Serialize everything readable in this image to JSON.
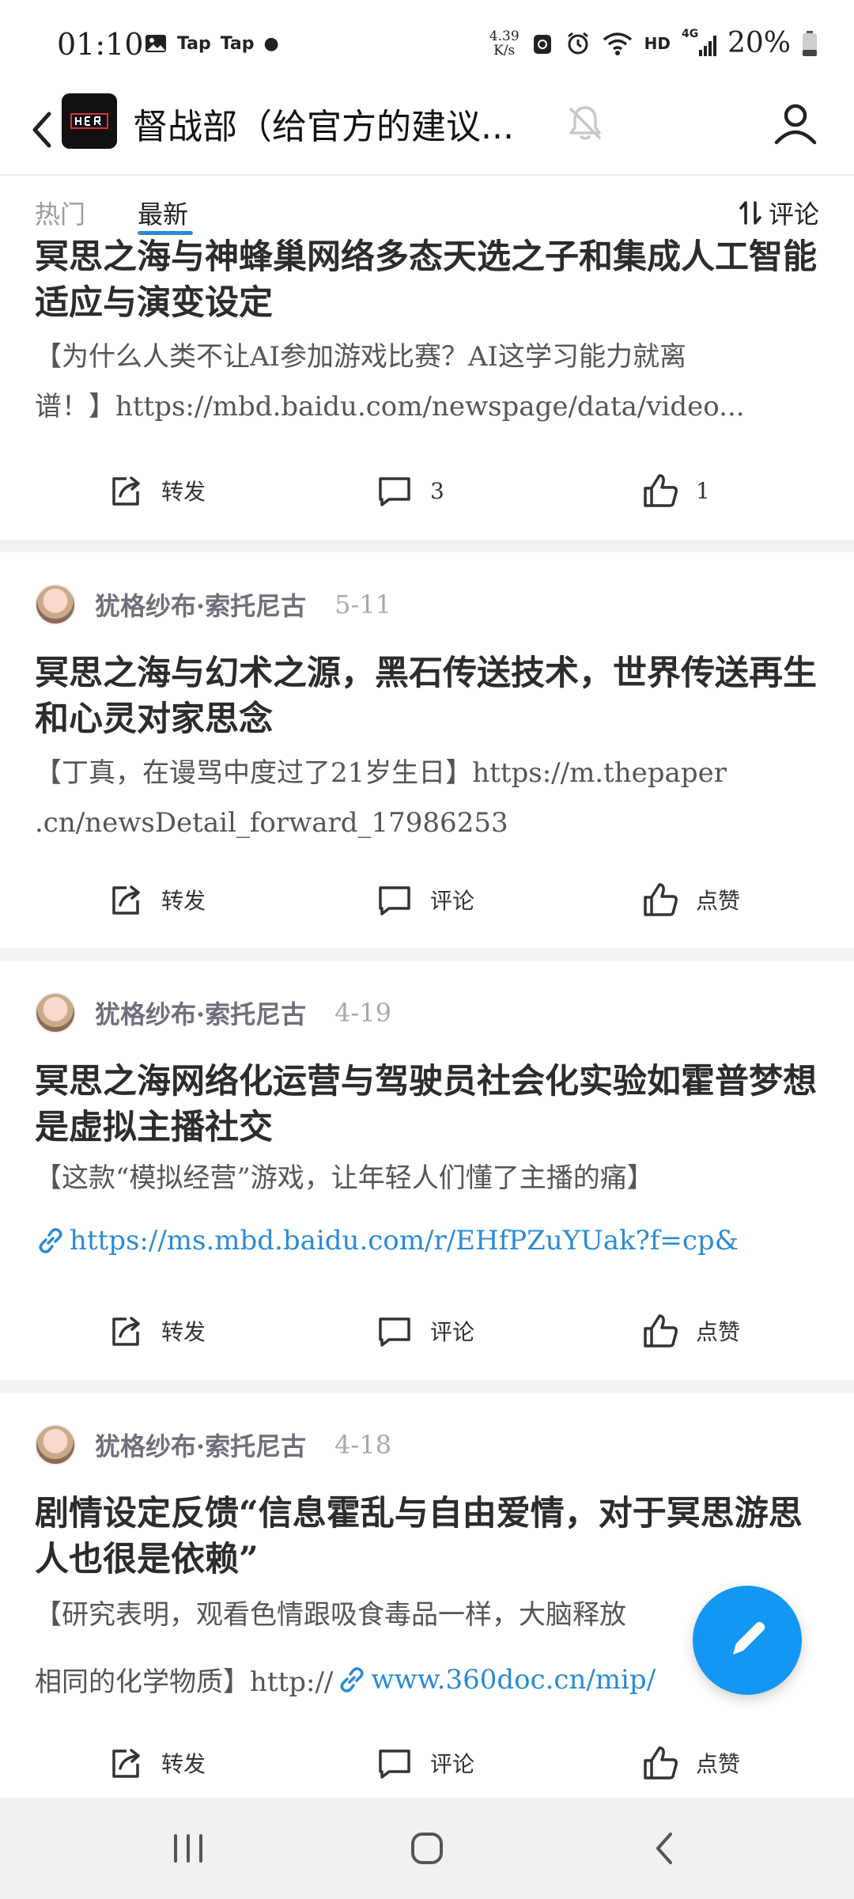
{
  "status_bar": {
    "time": "01:10",
    "apps": [
      "Tap",
      "Tap"
    ],
    "net_speed_value": "4.39",
    "net_speed_unit": "K/s",
    "hd": "HD",
    "network": "4G",
    "battery": "20%"
  },
  "header": {
    "title": "督战部（给官方的建议..."
  },
  "tabs": {
    "hot": "热门",
    "latest": "最新",
    "sort_label": "评论"
  },
  "posts": [
    {
      "title": "冥思之海与神蜂巢网络多态天选之子和集成人工智能 适应与演变设定",
      "summary_line1": "【为什么人类不让AI参加游戏比赛？AI这学习能力就离",
      "summary_line2": "谱！】https://mbd.baidu.com/newspage/data/video...",
      "share": "转发",
      "comment": "3",
      "like": "1"
    },
    {
      "author": "犹格纱布·索托尼古",
      "date": "5-11",
      "title": "冥思之海与幻术之源，黑石传送技术，世界传送再生和心灵对家思念",
      "summary_line1": "【丁真，在谩骂中度过了21岁生日】https://m.thepaper",
      "summary_line2": ".cn/newsDetail_forward_17986253",
      "share": "转发",
      "comment": "评论",
      "like": "点赞"
    },
    {
      "author": "犹格纱布·索托尼古",
      "date": "4-19",
      "title": "冥思之海网络化运营与驾驶员社会化实验如霍普梦想是虚拟主播社交",
      "summary_line1": "【这款“模拟经营”游戏，让年轻人们懂了主播的痛】",
      "link": "https://ms.mbd.baidu.com/r/EHfPZuYUak?f=cp&",
      "share": "转发",
      "comment": "评论",
      "like": "点赞"
    },
    {
      "author": "犹格纱布·索托尼古",
      "date": "4-18",
      "title": "剧情设定反馈“信息霍乱与自由爱情，对于冥思游思人也很是依赖”",
      "summary_line1": "【研究表明，观看色情跟吸食毒品一样，大脑释放",
      "summary_line2_prefix": "相同的化学物质】http://",
      "summary_line2_link": "www.360doc.cn/mip/",
      "share": "转发",
      "comment": "评论",
      "like": "点赞"
    }
  ],
  "colors": {
    "accent": "#2a8bd6",
    "fab": "#1497f2",
    "divider": "#f2f2f4"
  }
}
